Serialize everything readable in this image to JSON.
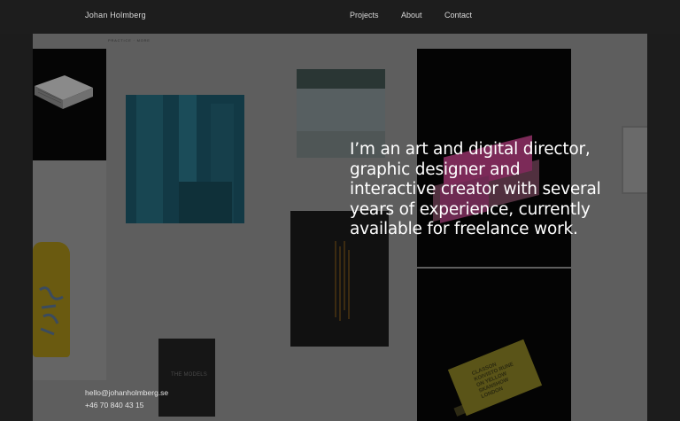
{
  "header": {
    "brand": "Johan Holmberg",
    "nav": [
      {
        "label": "Projects"
      },
      {
        "label": "About"
      },
      {
        "label": "Contact"
      }
    ]
  },
  "breadcrumb": "PRACTICE · MORE",
  "intro": "I’m an art and digital director, graphic designer and interactive creator with several years of experience, currently available for freelance work.",
  "contact": {
    "email": "hello@johanholmberg.se",
    "phone": "+46 70 840 43 15"
  },
  "gallery": {
    "models_book": {
      "title": "THE MODELS"
    },
    "yellow_book": {
      "text": "CLASSON KOIVISTO RUNE ON YELLOW SKANSHOW LONDON"
    }
  }
}
